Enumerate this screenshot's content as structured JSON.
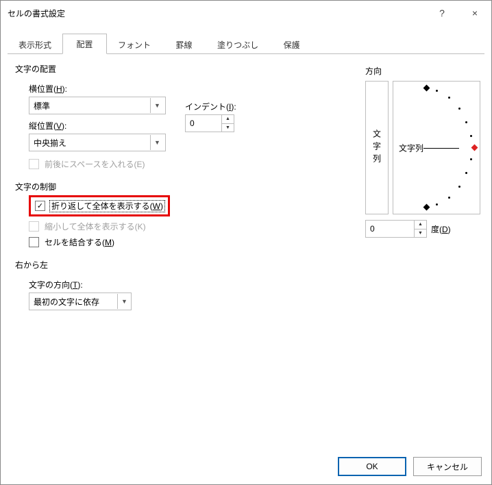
{
  "window": {
    "title": "セルの書式設定",
    "help": "?",
    "close": "×"
  },
  "tabs": {
    "items": [
      {
        "label": "表示形式"
      },
      {
        "label": "配置"
      },
      {
        "label": "フォント"
      },
      {
        "label": "罫線"
      },
      {
        "label": "塗りつぶし"
      },
      {
        "label": "保護"
      }
    ]
  },
  "textAlign": {
    "groupTitle": "文字の配置",
    "horizLabel_pre": "横位置(",
    "horizLabel_u": "H",
    "horizLabel_post": "):",
    "horizValue": "標準",
    "vertLabel_pre": "縦位置(",
    "vertLabel_u": "V",
    "vertLabel_post": "):",
    "vertValue": "中央揃え",
    "indentLabel_pre": "インデント(",
    "indentLabel_u": "I",
    "indentLabel_post": "):",
    "indentValue": "0",
    "justifyDistributed": "前後にスペースを入れる(E)"
  },
  "textControl": {
    "groupTitle": "文字の制御",
    "wrap_pre": "折り返して全体を表示する(",
    "wrap_u": "W",
    "wrap_post": ")",
    "shrink": "縮小して全体を表示する(K)",
    "merge_pre": "セルを結合する(",
    "merge_u": "M",
    "merge_post": ")"
  },
  "rtl": {
    "groupTitle": "右から左",
    "dirLabel_pre": "文字の方向(",
    "dirLabel_u": "T",
    "dirLabel_post": "):",
    "dirValue": "最初の文字に依存"
  },
  "orientation": {
    "title": "方向",
    "vertText": "文字列",
    "arcLabel": "文字列",
    "degValue": "0",
    "degLabel_pre": "度(",
    "degLabel_u": "D",
    "degLabel_post": ")"
  },
  "buttons": {
    "ok": "OK",
    "cancel": "キャンセル"
  }
}
